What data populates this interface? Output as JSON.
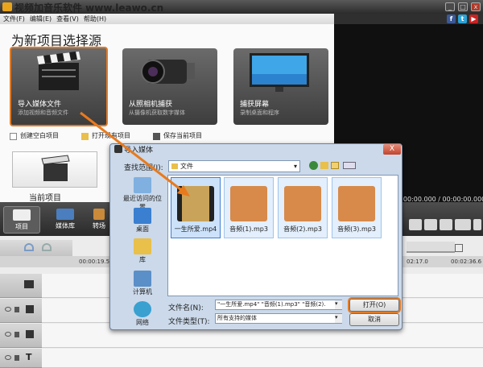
{
  "app": {
    "title": "视频加音乐软件 www.leawo.cn"
  },
  "menu": [
    "文件(F)",
    "编辑(E)",
    "查看(V)",
    "帮助(H)"
  ],
  "social": [
    {
      "label": "f",
      "color": "#3b5998"
    },
    {
      "label": "t",
      "color": "#29a3d8"
    },
    {
      "label": "▶",
      "color": "#cc2222"
    }
  ],
  "source": {
    "heading": "为新项目选择源",
    "cards": [
      {
        "title": "导入媒体文件",
        "subtitle": "添加视频和音频文件"
      },
      {
        "title": "从照相机捕获",
        "subtitle": "从摄像机获取数字媒体"
      },
      {
        "title": "捕获屏幕",
        "subtitle": "录制桌面和程序"
      }
    ],
    "actions": [
      "创建空白项目",
      "打开现有项目",
      "保存当前项目"
    ],
    "current_project": "当前项目"
  },
  "preview": {
    "time": "00:00:00.000 / 00:00:00.000"
  },
  "toolbar": {
    "items": [
      "项目",
      "媒体库",
      "转场"
    ]
  },
  "timeline": {
    "ticks": [
      "00:00:19.5",
      "02:17.0",
      "00:02:36.6"
    ]
  },
  "dialog": {
    "title": "导入媒体",
    "lookin_label": "查找范围(I):",
    "lookin_value": "文件",
    "places": [
      "最近访问的位置",
      "桌面",
      "库",
      "计算机",
      "网络"
    ],
    "files": [
      "一生所爱.mp4",
      "音频(1).mp3",
      "音频(2).mp3",
      "音频(3).mp3"
    ],
    "filename_label": "文件名(N):",
    "filename_value": "\"一生所爱.mp4\" \"音频(1).mp3\" \"音频(2).",
    "filetype_label": "文件类型(T):",
    "filetype_value": "所有支持的媒体",
    "open_label": "打开(O)",
    "cancel_label": "取消",
    "close_label": "X"
  }
}
